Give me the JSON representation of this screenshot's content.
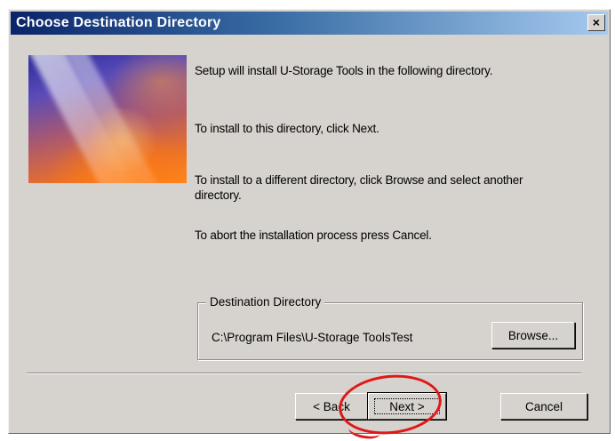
{
  "window": {
    "title": "Choose Destination Directory",
    "close_glyph": "×"
  },
  "message": {
    "line1": "Setup will install U-Storage Tools in the following directory.",
    "line2": "To install to this directory, click Next.",
    "line3": "To install to a different directory, click Browse and select another directory.",
    "line4": "To abort the installation process press Cancel."
  },
  "destination": {
    "group_label": "Destination Directory",
    "path": "C:\\Program Files\\U-Storage ToolsTest",
    "browse_label": "Browse..."
  },
  "buttons": {
    "back_label": "< Back",
    "next_label": "Next >",
    "cancel_label": "Cancel"
  },
  "colors": {
    "annotation": "#e01818",
    "titlebar_start": "#0a246a",
    "titlebar_end": "#a6caf0",
    "face": "#d6d3ce"
  }
}
